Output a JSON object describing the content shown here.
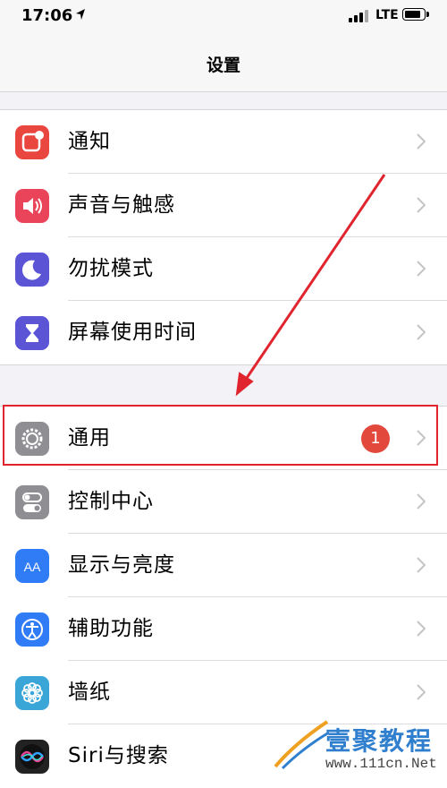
{
  "status_bar": {
    "time": "17:06",
    "network": "LTE",
    "battery_level": 0.7
  },
  "header": {
    "title": "设置"
  },
  "groups": [
    {
      "rows": [
        {
          "label": "通知",
          "icon": "notifications-icon",
          "icon_color": "#e9463f"
        },
        {
          "label": "声音与触感",
          "icon": "sounds-icon",
          "icon_color": "#e9445a"
        },
        {
          "label": "勿扰模式",
          "icon": "moon-icon",
          "icon_color": "#5b55d6"
        },
        {
          "label": "屏幕使用时间",
          "icon": "hourglass-icon",
          "icon_color": "#5b55d6"
        }
      ]
    },
    {
      "rows": [
        {
          "label": "通用",
          "icon": "gear-icon",
          "icon_color": "#8e8e93",
          "badge": "1"
        },
        {
          "label": "控制中心",
          "icon": "toggles-icon",
          "icon_color": "#8e8e93"
        },
        {
          "label": "显示与亮度",
          "icon": "text-size-icon",
          "icon_color": "#2f7cf6"
        },
        {
          "label": "辅助功能",
          "icon": "accessibility-icon",
          "icon_color": "#2f7cf6"
        },
        {
          "label": "墙纸",
          "icon": "wallpaper-icon",
          "icon_color": "#3aa6d8"
        },
        {
          "label": "Siri与搜索",
          "icon": "siri-icon",
          "icon_color": "#222"
        }
      ]
    }
  ],
  "annotation": {
    "highlight_color": "#e0252f"
  },
  "watermark": {
    "text": "壹聚教程",
    "url": "www.111cn.Net"
  }
}
